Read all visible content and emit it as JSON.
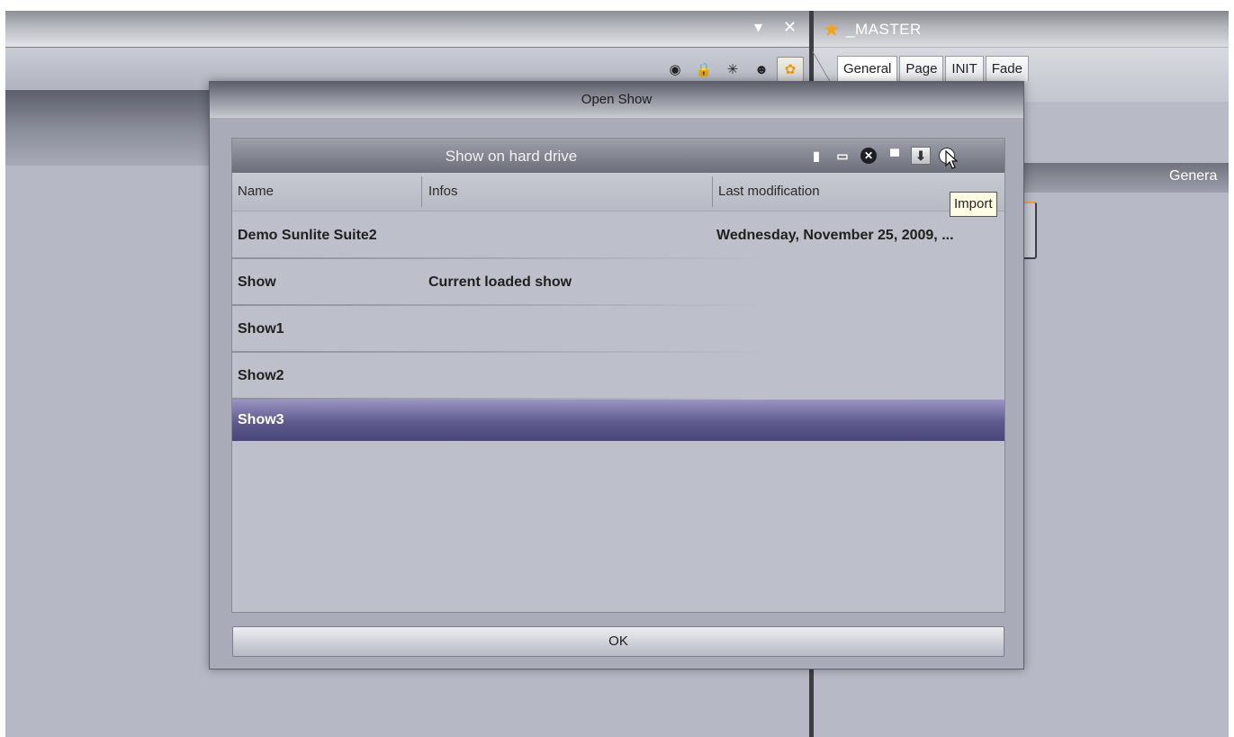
{
  "main_window": {
    "controls": {
      "dropdown_glyph": "▾",
      "close_glyph": "✕"
    },
    "toolbar_icons": [
      {
        "name": "eye-icon",
        "glyph": "◉"
      },
      {
        "name": "lock-icon",
        "glyph": "🔒"
      },
      {
        "name": "sun-icon",
        "glyph": "✳"
      },
      {
        "name": "face-icon",
        "glyph": "☻"
      },
      {
        "name": "star-icon",
        "glyph": "✿"
      }
    ]
  },
  "right_panel": {
    "title": "_MASTER",
    "tabs": [
      "General",
      "Page",
      "INIT",
      "Fade"
    ],
    "section_label": "Genera"
  },
  "dialog": {
    "title": "Open Show",
    "panel_title": "Show on hard drive",
    "tools": [
      {
        "name": "new-file-icon",
        "glyph": "▮"
      },
      {
        "name": "rename-icon",
        "glyph": "▭"
      },
      {
        "name": "delete-icon",
        "glyph": "✕"
      },
      {
        "name": "save-icon",
        "glyph": "▀"
      },
      {
        "name": "import-icon",
        "glyph": "⬇"
      },
      {
        "name": "info-icon",
        "glyph": "i"
      }
    ],
    "tooltip": "Import",
    "columns": [
      "Name",
      "Infos",
      "Last modification"
    ],
    "rows": [
      {
        "name": "Demo Sunlite Suite2",
        "infos": "",
        "modified": "Wednesday, November 25, 2009, ..."
      },
      {
        "name": "Show",
        "infos": "Current loaded show",
        "modified": ""
      },
      {
        "name": "Show1",
        "infos": "",
        "modified": ""
      },
      {
        "name": "Show2",
        "infos": "",
        "modified": ""
      },
      {
        "name": "Show3",
        "infos": "",
        "modified": "",
        "selected": true
      }
    ],
    "ok_label": "OK"
  },
  "colors": {
    "selection_top": "#9a95c4",
    "selection_bottom": "#49467a",
    "star_accent": "#f4a21c"
  }
}
